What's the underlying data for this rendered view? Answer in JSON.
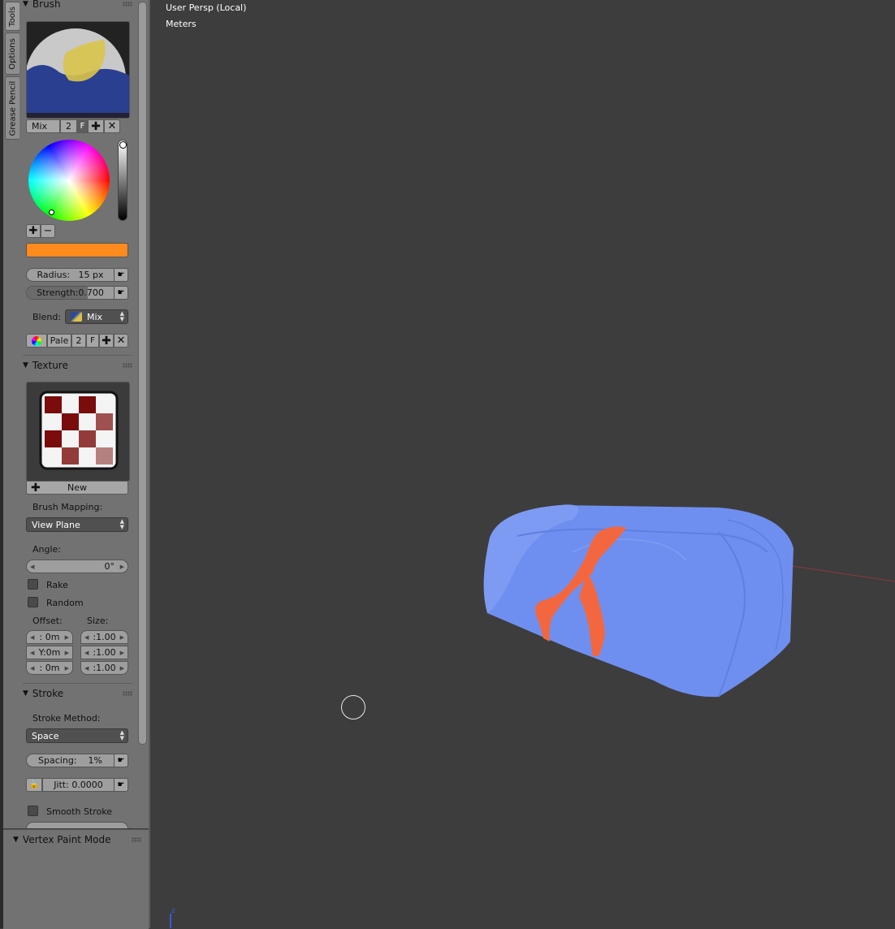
{
  "vtabs": [
    "Tools",
    "Options",
    "Grease Pencil"
  ],
  "brush": {
    "header": "Brush",
    "name": "Mix",
    "users": "2",
    "fake_user": "F",
    "radius_label": "Radius:",
    "radius_value": "15 px",
    "strength_label": "Strength:",
    "strength_value": "0.700",
    "blend_label": "Blend:",
    "blend_value": "Mix",
    "palette_name": "Pale",
    "palette_users": "2",
    "palette_fake": "F",
    "color": "#ff8a1e"
  },
  "texture": {
    "header": "Texture",
    "new_label": "New",
    "mapping_label": "Brush Mapping:",
    "mapping_value": "View Plane",
    "angle_label": "Angle:",
    "angle_value": "0°",
    "rake_label": "Rake",
    "random_label": "Random",
    "offset_label": "Offset:",
    "size_label": "Size:",
    "offset_values": [
      ": 0m",
      "Y:0m",
      ": 0m"
    ],
    "size_values": [
      ":1.00",
      ":1.00",
      ":1.00"
    ]
  },
  "stroke": {
    "header": "Stroke",
    "method_label": "Stroke Method:",
    "method_value": "Space",
    "spacing_label": "Spacing:",
    "spacing_value": "1%",
    "jitter_value": "Jitt: 0.0000",
    "smooth_label": "Smooth Stroke"
  },
  "mode_panel": {
    "title": "Vertex Paint Mode"
  },
  "viewport": {
    "view_name": "User Persp (Local)",
    "units": "Meters",
    "mesh_color": "#6f8ff0",
    "paint_color": "#f2673f"
  }
}
